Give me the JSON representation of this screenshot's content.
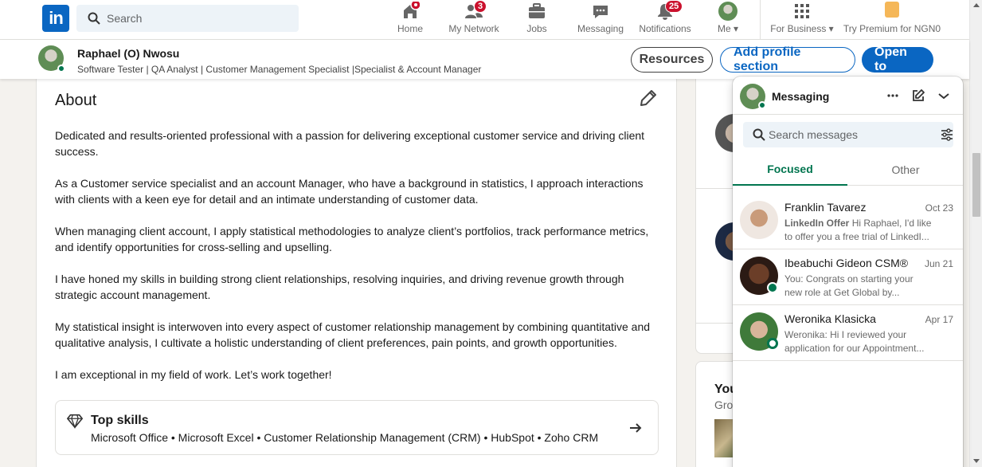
{
  "nav": {
    "logo": "in",
    "search_placeholder": "Search",
    "items": [
      {
        "label": "Home",
        "badge": ""
      },
      {
        "label": "My Network",
        "badge": "3"
      },
      {
        "label": "Jobs",
        "badge": ""
      },
      {
        "label": "Messaging",
        "badge": ""
      },
      {
        "label": "Notifications",
        "badge": "25"
      },
      {
        "label": "Me ▾",
        "badge": ""
      },
      {
        "label": "For Business ▾",
        "badge": ""
      }
    ],
    "premium": "Try Premium for NGN0"
  },
  "profile_header": {
    "name": "Raphael (O) Nwosu",
    "headline": "Software Tester | QA Analyst | Customer Management Specialist |Specialist & Account Manager",
    "buttons": {
      "resources": "Resources",
      "add_section": "Add profile section",
      "open_to": "Open to"
    }
  },
  "about": {
    "title": "About",
    "paragraphs": [
      "Dedicated and results-oriented professional with a passion for delivering exceptional customer service and driving client success.",
      "As a Customer service specialist and an account Manager, who have a background in statistics, I approach interactions with clients with a keen eye for detail and an intimate understanding of customer data.",
      "When managing client account, I apply statistical methodologies to analyze client’s portfolios, track performance metrics, and identify opportunities for cross-selling and upselling.",
      "I have honed my skills in building strong client relationships, resolving inquiries, and driving revenue growth through strategic account management.",
      "My statistical insight is interwoven into every aspect of customer relationship management by combining quantitative and qualitative analysis, I cultivate a holistic understanding of client preferences, pain points, and growth opportunities.",
      "I am exceptional in my field of work. Let’s work together!"
    ],
    "top_skills_title": "Top skills",
    "top_skills": "Microsoft Office • Microsoft Excel • Customer Relationship Management (CRM) • HubSpot • Zoho CRM"
  },
  "right_rail": {
    "title_fragment": "You",
    "sub_fragment": "Gro"
  },
  "messaging": {
    "title": "Messaging",
    "search_placeholder": "Search messages",
    "tabs": {
      "focused": "Focused",
      "other": "Other"
    },
    "conversations": [
      {
        "name": "Franklin Tavarez",
        "date": "Oct 23",
        "sponsor": "LinkedIn Offer",
        "preview_line1": "Hi Raphael, I'd like",
        "preview_line2": "to offer you a free trial of LinkedI..."
      },
      {
        "name": "Ibeabuchi Gideon CSM®",
        "date": "Jun 21",
        "sponsor": "",
        "preview_line1": "You: Congrats on starting your",
        "preview_line2": "new role at Get Global by..."
      },
      {
        "name": "Weronika Klasicka",
        "date": "Apr 17",
        "sponsor": "",
        "preview_line1": "Weronika: Hi I reviewed your",
        "preview_line2": "application for our Appointment..."
      }
    ]
  },
  "colors": {
    "brand": "#0a66c2",
    "focus_green": "#01754f",
    "badge_red": "#cb112d",
    "page_bg": "#f4f2ee"
  }
}
